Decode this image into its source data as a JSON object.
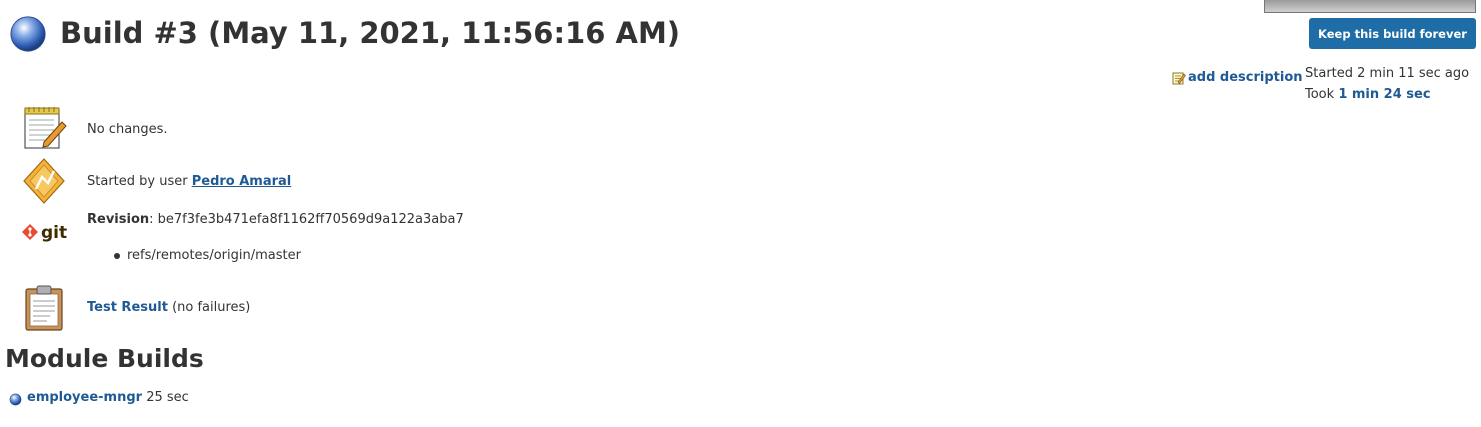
{
  "header": {
    "title": "Build #3 (May 11, 2021, 11:56:16 AM)",
    "status_icon": "blue-ball-icon",
    "status_color": "#3f6fc8"
  },
  "actions": {
    "keep_forever_label": "Keep this build forever",
    "add_description_label": "add description"
  },
  "build_info": {
    "started_text": "Started 2 min 11 sec ago",
    "took_prefix": "Took ",
    "took_value": "1 min 24 sec"
  },
  "details": {
    "changes_text": "No changes.",
    "started_by_prefix": "Started by user ",
    "started_by_user": "Pedro Amaral",
    "revision_label": "Revision",
    "revision_sep": ": ",
    "revision_hash": "be7f3fe3b471efa8f1162ff70569d9a122a3aba7",
    "refs": [
      "refs/remotes/origin/master"
    ],
    "git_logo_text": "git",
    "test_result_link": "Test Result",
    "test_result_suffix": " (no failures)"
  },
  "modules": {
    "heading": "Module Builds",
    "items": [
      {
        "name": "employee-mngr",
        "duration": " 25 sec"
      }
    ]
  },
  "colors": {
    "link": "#1f5a94",
    "button": "#1f6da6",
    "text": "#333333"
  }
}
